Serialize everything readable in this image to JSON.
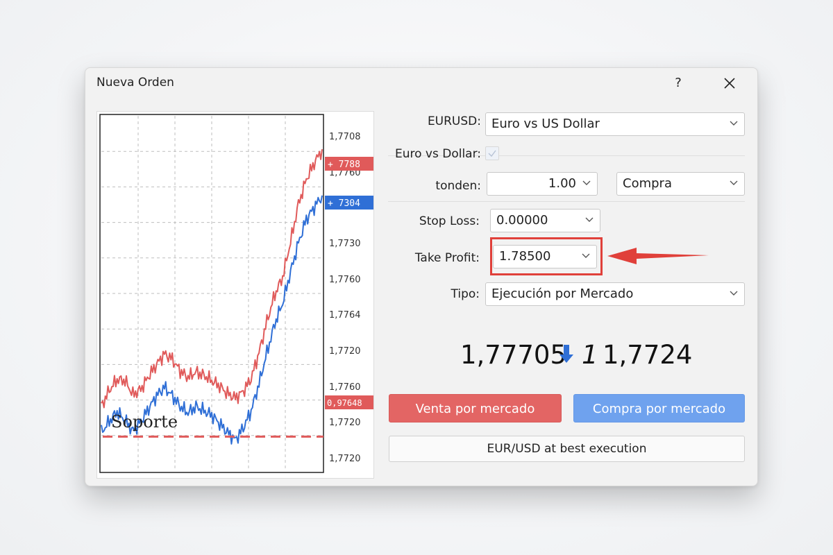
{
  "window": {
    "title": "Nueva Orden",
    "help_label": "?"
  },
  "form": {
    "symbol_label": "EURUSD:",
    "symbol_value": "Euro vs US Dollar",
    "check_label": "Euro vs Dollar:",
    "volume_label": "tonden:",
    "volume_value": "1.00",
    "side_value": "Compra",
    "stop_loss_label": "Stop Loss:",
    "stop_loss_value": "0.00000",
    "take_profit_label": "Take Profit:",
    "take_profit_value": "1.78500",
    "type_label": "Tipo:",
    "type_value": "Ejecución por Mercado"
  },
  "quotes": {
    "bid": "1,77705",
    "separator": "1",
    "ask": "1,7724"
  },
  "buttons": {
    "sell": "Venta por mercado",
    "buy": "Compra por mercado",
    "execution": "EUR/USD at best execution"
  },
  "colors": {
    "sell": "#e36564",
    "buy": "#6fa2ee",
    "highlight": "#e0403a",
    "bid_line": "#e05a5a",
    "ask_line": "#2f6fd6"
  },
  "chart_data": {
    "type": "line",
    "y_axis_labels": [
      "1,7708",
      "1,7760",
      "1,7730",
      "1,7760",
      "1,7764",
      "1,7720",
      "1,7760",
      "1,7720",
      "1,7720"
    ],
    "price_tags": [
      {
        "text": "+ 7788",
        "color": "#e05a5a"
      },
      {
        "text": "+ 7304",
        "color": "#2f6fd6"
      },
      {
        "text": "0,97648",
        "color": "#e05a5a"
      }
    ],
    "support_label": "Soporte",
    "series": [
      {
        "color": "#e05a5a",
        "values": [
          6,
          7.5,
          8.5,
          8.4,
          7.1,
          7.6,
          8.8,
          9.9,
          10.9,
          10.4,
          9.3,
          8.7,
          9.2,
          8.9,
          8.4,
          7.9,
          7.2,
          6.8,
          7.4,
          8.6,
          11.0,
          13.9,
          16.4,
          18.0,
          21.3,
          24.8,
          27.1,
          28.6,
          29.9
        ]
      },
      {
        "color": "#2f6fd6",
        "values": [
          3.6,
          4.6,
          5.5,
          4.7,
          3.7,
          4.6,
          5.8,
          7.0,
          7.8,
          7.0,
          6.0,
          5.4,
          6.0,
          5.6,
          5.2,
          4.4,
          3.6,
          2.9,
          4.0,
          5.6,
          8.1,
          11.0,
          13.7,
          15.6,
          18.5,
          21.2,
          23.4,
          24.5,
          25.6
        ]
      }
    ],
    "support_level": 1.2,
    "ylim": [
      0,
      33
    ],
    "grid": true
  }
}
